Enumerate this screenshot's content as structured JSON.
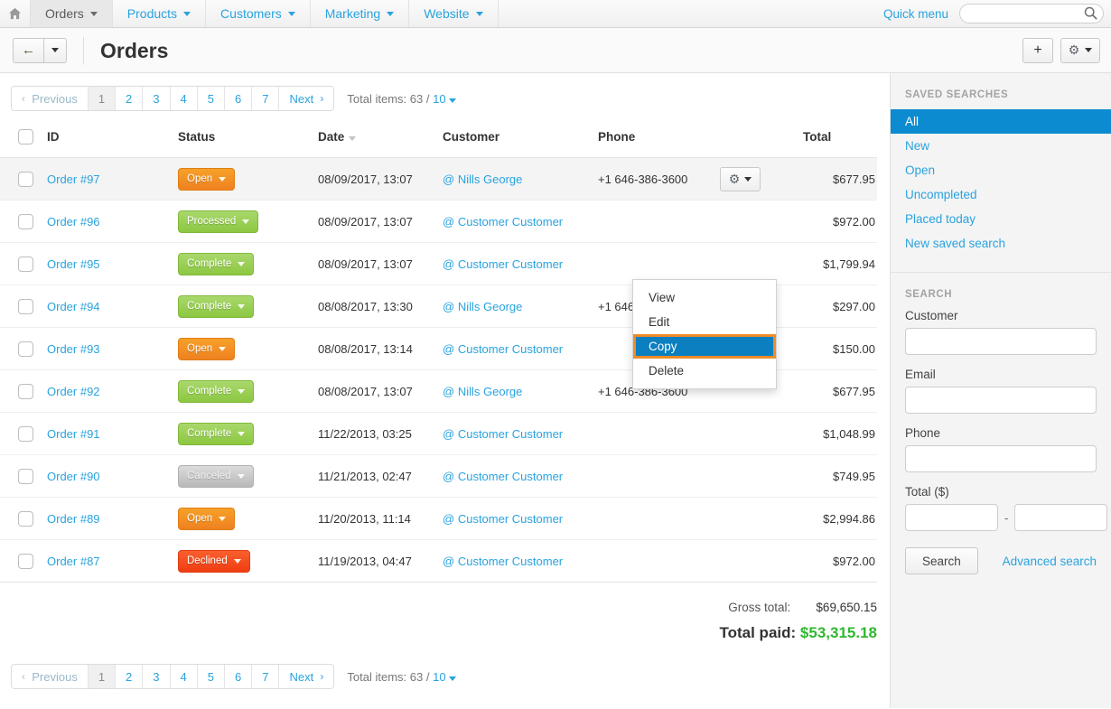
{
  "topnav": {
    "home_icon": "home-icon",
    "items": [
      {
        "label": "Orders",
        "active": true
      },
      {
        "label": "Products",
        "active": false
      },
      {
        "label": "Customers",
        "active": false
      },
      {
        "label": "Marketing",
        "active": false
      },
      {
        "label": "Website",
        "active": false
      }
    ],
    "quick_menu": "Quick menu",
    "search_value": "",
    "search_placeholder": "",
    "search_icon": "search-icon"
  },
  "header": {
    "back_icon": "arrow-left-icon",
    "title": "Orders",
    "add_icon": "plus-icon",
    "gear_icon": "gear-icon"
  },
  "pagination": {
    "previous": "Previous",
    "pages": [
      "1",
      "2",
      "3",
      "4",
      "5",
      "6",
      "7"
    ],
    "current_page": "1",
    "next": "Next",
    "total_label": "Total items:",
    "total_count": "63",
    "separator": "/",
    "per_page": "10"
  },
  "table": {
    "columns": [
      "ID",
      "Status",
      "Date",
      "Customer",
      "Phone",
      "Total"
    ],
    "sorted_column": "Date",
    "sort_direction": "desc",
    "rows": [
      {
        "id": "Order #97",
        "status": "Open",
        "status_class": "open",
        "date": "08/09/2017, 13:07",
        "customer": "Nills George",
        "phone": "+1 646-386-3600",
        "total": "$677.95",
        "selected": true,
        "menu_open": true
      },
      {
        "id": "Order #96",
        "status": "Processed",
        "status_class": "processed",
        "date": "08/09/2017, 13:07",
        "customer": "Customer Customer",
        "phone": "",
        "total": "$972.00",
        "selected": false,
        "menu_open": false
      },
      {
        "id": "Order #95",
        "status": "Complete",
        "status_class": "complete",
        "date": "08/09/2017, 13:07",
        "customer": "Customer Customer",
        "phone": "",
        "total": "$1,799.94",
        "selected": false,
        "menu_open": false
      },
      {
        "id": "Order #94",
        "status": "Complete",
        "status_class": "complete",
        "date": "08/08/2017, 13:30",
        "customer": "Nills George",
        "phone": "+1 646-386-3600",
        "total": "$297.00",
        "selected": false,
        "menu_open": false
      },
      {
        "id": "Order #93",
        "status": "Open",
        "status_class": "open",
        "date": "08/08/2017, 13:14",
        "customer": "Customer Customer",
        "phone": "",
        "total": "$150.00",
        "selected": false,
        "menu_open": false
      },
      {
        "id": "Order #92",
        "status": "Complete",
        "status_class": "complete",
        "date": "08/08/2017, 13:07",
        "customer": "Nills George",
        "phone": "+1 646-386-3600",
        "total": "$677.95",
        "selected": false,
        "menu_open": false
      },
      {
        "id": "Order #91",
        "status": "Complete",
        "status_class": "complete",
        "date": "11/22/2013, 03:25",
        "customer": "Customer Customer",
        "phone": "",
        "total": "$1,048.99",
        "selected": false,
        "menu_open": false
      },
      {
        "id": "Order #90",
        "status": "Canceled",
        "status_class": "canceled",
        "date": "11/21/2013, 02:47",
        "customer": "Customer Customer",
        "phone": "",
        "total": "$749.95",
        "selected": false,
        "menu_open": false
      },
      {
        "id": "Order #89",
        "status": "Open",
        "status_class": "open",
        "date": "11/20/2013, 11:14",
        "customer": "Customer Customer",
        "phone": "",
        "total": "$2,994.86",
        "selected": false,
        "menu_open": false
      },
      {
        "id": "Order #87",
        "status": "Declined",
        "status_class": "declined",
        "date": "11/19/2013, 04:47",
        "customer": "Customer Customer",
        "phone": "",
        "total": "$972.00",
        "selected": false,
        "menu_open": false
      }
    ]
  },
  "row_menu": {
    "items": [
      "View",
      "Edit",
      "Copy",
      "Delete"
    ],
    "highlighted": "Copy",
    "highlight_bg": "#0b7fc0",
    "highlight_border": "#f08b26"
  },
  "totals": {
    "gross_label": "Gross total:",
    "gross_value": "$69,650.15",
    "paid_label": "Total paid:",
    "paid_value": "$53,315.18",
    "paid_color": "#2eb82e"
  },
  "sidebar": {
    "saved_searches_title": "SAVED SEARCHES",
    "saved_searches": [
      {
        "label": "All",
        "active": true
      },
      {
        "label": "New",
        "active": false
      },
      {
        "label": "Open",
        "active": false
      },
      {
        "label": "Uncompleted",
        "active": false
      },
      {
        "label": "Placed today",
        "active": false
      },
      {
        "label": "New saved search",
        "active": false
      }
    ],
    "search_title": "SEARCH",
    "fields": {
      "customer_label": "Customer",
      "customer_value": "",
      "email_label": "Email",
      "email_value": "",
      "phone_label": "Phone",
      "phone_value": "",
      "total_label": "Total ($)",
      "total_min": "",
      "total_max": "",
      "range_dash": "-"
    },
    "search_button": "Search",
    "advanced_search": "Advanced search"
  },
  "colors": {
    "link": "#29a3df",
    "active_blue": "#0d8bd0",
    "orange": "#ef8120",
    "green": "#8cc741",
    "red": "#f03d12",
    "gray": "#b8b8b8"
  }
}
